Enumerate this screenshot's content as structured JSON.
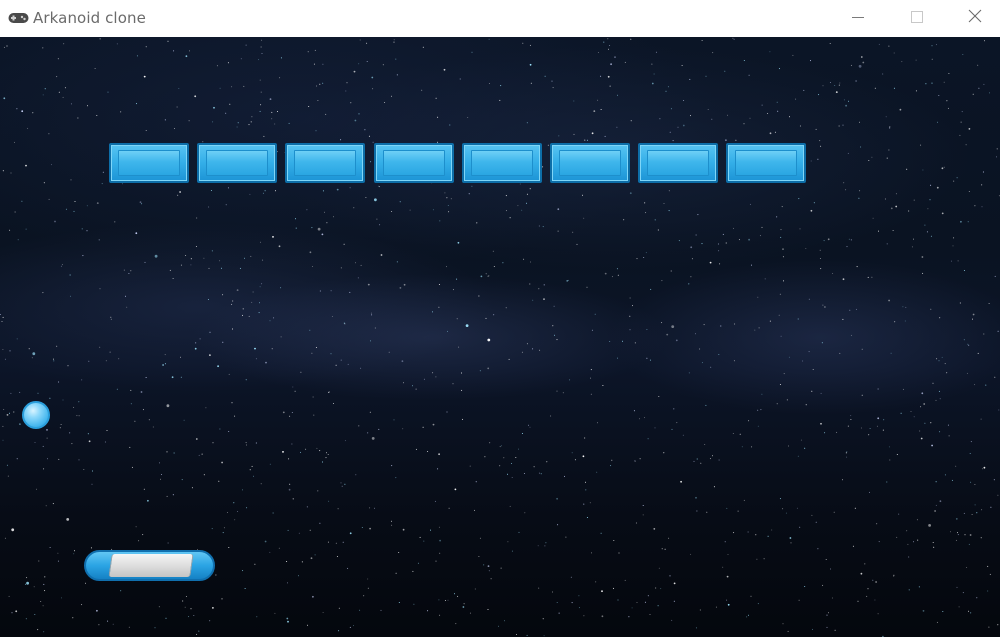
{
  "window": {
    "title": "Arkanoid clone",
    "app_icon": "gamepad-icon",
    "controls": {
      "minimize_icon": "minimize-icon",
      "maximize_icon": "maximize-icon",
      "close_icon": "close-icon"
    }
  },
  "game": {
    "background": "starfield",
    "brick_row": {
      "count": 8,
      "color": "#33aee8",
      "bricks": [
        {
          "id": 1
        },
        {
          "id": 2
        },
        {
          "id": 3
        },
        {
          "id": 4
        },
        {
          "id": 5
        },
        {
          "id": 6
        },
        {
          "id": 7
        },
        {
          "id": 8
        }
      ]
    },
    "ball": {
      "color": "#46b7ee"
    },
    "paddle": {
      "color": "#2ba4e4",
      "core_color": "#dedede"
    }
  }
}
